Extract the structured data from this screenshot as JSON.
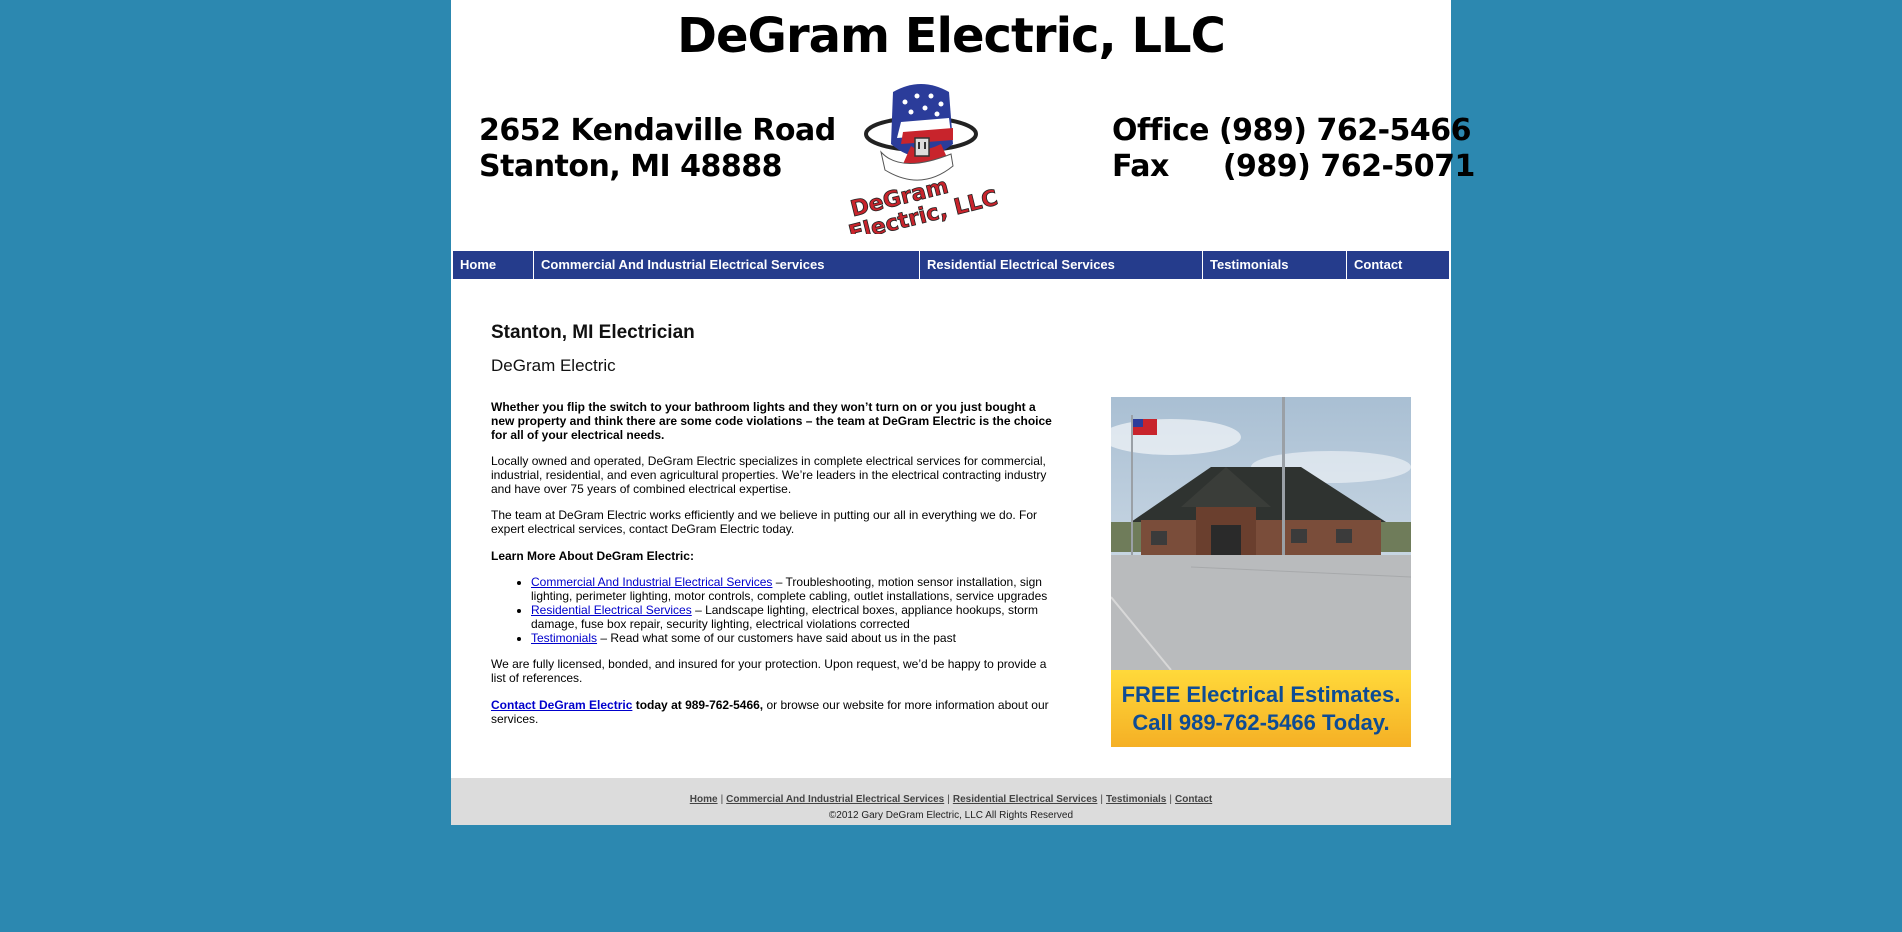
{
  "header": {
    "site_title": "DeGram Electric, LLC",
    "address_line1": "2652 Kendaville Road",
    "address_line2": "Stanton, MI 48888",
    "office_line": "Office (989) 762-5466",
    "fax_label": "Fax",
    "fax_number": "(989) 762-5071",
    "logo_text_line1": "DeGram",
    "logo_text_line2": "Electric, LLC"
  },
  "nav": {
    "items": [
      {
        "label": "Home"
      },
      {
        "label": "Commercial And Industrial Electrical Services"
      },
      {
        "label": "Residential Electrical Services"
      },
      {
        "label": "Testimonials"
      },
      {
        "label": "Contact"
      }
    ]
  },
  "main": {
    "heading": "Stanton, MI Electrician",
    "subheading": "DeGram Electric",
    "intro": "Whether you flip the switch to your bathroom lights and they won’t turn on or you just bought a new property and think there are some code violations – the team at DeGram Electric is the choice for all of your electrical needs.",
    "para2": "Locally owned and operated, DeGram Electric specializes in complete electrical services for commercial, industrial, residential, and even agricultural properties. We’re leaders in the electrical contracting industry and have over 75 years of combined electrical expertise.",
    "para3": "The team at DeGram Electric works efficiently and we believe in putting our all in everything we do. For expert electrical services, contact DeGram Electric today.",
    "learn_more": "Learn More About DeGram Electric:",
    "services": [
      {
        "link": "Commercial And Industrial Electrical Services",
        "text": " – Troubleshooting, motion sensor installation, sign lighting, perimeter lighting, motor controls, complete cabling, outlet installations, service upgrades"
      },
      {
        "link": "Residential Electrical Services",
        "text": " – Landscape lighting, electrical boxes, appliance hookups, storm damage, fuse box repair, security lighting, electrical violations corrected"
      },
      {
        "link": "Testimonials",
        "text": " – Read what some of our customers have said about us in the past"
      }
    ],
    "para4": "We are fully licensed, bonded, and insured for your protection. Upon request, we’d be happy to provide a list of references.",
    "contact_link": "Contact DeGram Electric",
    "contact_bold": " today at 989-762-5466,",
    "contact_rest": " or browse our website for more information about our services."
  },
  "promo": {
    "line1": "FREE Electrical Estimates.",
    "line2": "Call 989-762-5466 Today."
  },
  "footer": {
    "links": [
      "Home",
      "Commercial And Industrial Electrical Services",
      "Residential Electrical Services",
      "Testimonials",
      "Contact"
    ],
    "separator": "|",
    "copyright": "©2012 Gary DeGram Electric, LLC All Rights Reserved"
  },
  "colors": {
    "background": "#2c88b0",
    "nav": "#253c8c",
    "banner": "#f5c030",
    "banner_text": "#0e4c94",
    "footer": "#dcdcdc"
  }
}
